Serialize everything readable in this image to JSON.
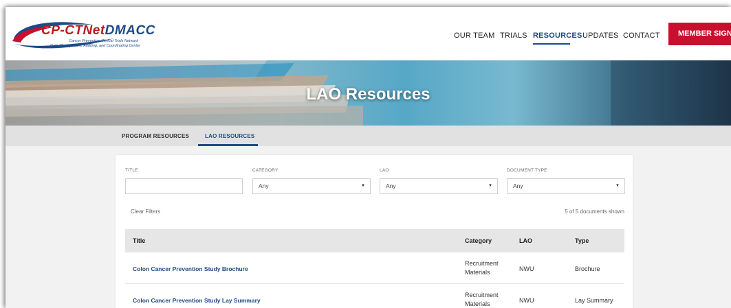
{
  "logo": {
    "name_part1": "CP-CTNet",
    "name_part2": "DMACC",
    "subtitle1": "Cancer Prevention Clinical Trials Network",
    "subtitle2": "Data Management, Auditing, and Coordinating Center"
  },
  "nav": {
    "items": [
      {
        "label": "OUR TEAM"
      },
      {
        "label": "TRIALS"
      },
      {
        "label": "RESOURCES"
      },
      {
        "label": "UPDATES"
      },
      {
        "label": "CONTACT"
      }
    ],
    "active": "RESOURCES",
    "signin_label": "MEMBER SIGNIN"
  },
  "hero": {
    "title": "LAO Resources"
  },
  "tabs": [
    {
      "label": "PROGRAM RESOURCES"
    },
    {
      "label": "LAO RESOURCES"
    }
  ],
  "active_tab": "LAO RESOURCES",
  "filters": {
    "title": {
      "label": "TITLE",
      "value": ""
    },
    "category": {
      "label": "CATEGORY",
      "value": "Any"
    },
    "lao": {
      "label": "LAO",
      "value": "Any"
    },
    "document_type": {
      "label": "DOCUMENT TYPE",
      "value": "Any"
    },
    "clear_label": "Clear Filters",
    "count_text": "5 of 5 documents shown"
  },
  "table": {
    "columns": [
      "Title",
      "Category",
      "LAO",
      "Type"
    ],
    "rows": [
      {
        "title": "Colon Cancer Prevention Study Brochure",
        "category": "Recruitment Materials",
        "lao": "NWU",
        "type": "Brochure"
      },
      {
        "title": "Colon Cancer Prevention Study Lay Summary",
        "category": "Recruitment Materials",
        "lao": "NWU",
        "type": "Lay Summary"
      }
    ]
  },
  "colors": {
    "brand_blue": "#1e4b87",
    "brand_red": "#c8102e"
  }
}
